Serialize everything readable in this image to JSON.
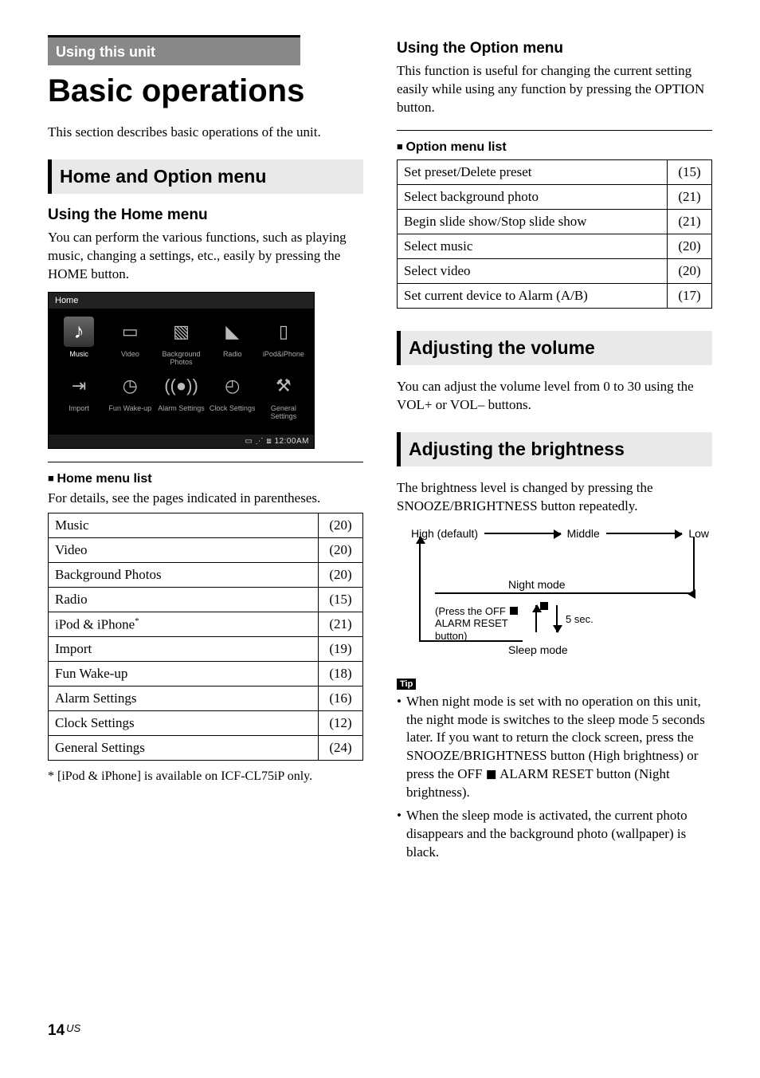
{
  "section_tag": "Using this unit",
  "page_title": "Basic operations",
  "intro": "This section describes basic operations of the unit.",
  "home_option_heading": "Home and Option menu",
  "using_home_heading": "Using the Home menu",
  "using_home_body": "You can perform the various functions, such as playing music, changing a settings, etc., easily by pressing the HOME button.",
  "screenshot": {
    "title": "Home",
    "items": [
      {
        "label": "Music",
        "glyph": "♪",
        "selected": true
      },
      {
        "label": "Video",
        "glyph": "▭",
        "selected": false
      },
      {
        "label": "Background Photos",
        "glyph": "▧",
        "selected": false
      },
      {
        "label": "Radio",
        "glyph": "◣",
        "selected": false
      },
      {
        "label": "iPod&iPhone",
        "glyph": "▯",
        "selected": false
      },
      {
        "label": "Import",
        "glyph": "⇥",
        "selected": false
      },
      {
        "label": "Fun Wake-up",
        "glyph": "◷",
        "selected": false
      },
      {
        "label": "Alarm Settings",
        "glyph": "((●))",
        "selected": false
      },
      {
        "label": "Clock Settings",
        "glyph": "◴",
        "selected": false
      },
      {
        "label": "General Settings",
        "glyph": "⚒",
        "selected": false
      }
    ],
    "status": "▭ ⋰ ⧈ 12:00AM"
  },
  "home_list_heading": "Home menu list",
  "home_list_caption": "For details, see the pages indicated in parentheses.",
  "home_list": [
    {
      "label": "Music",
      "page": "(20)"
    },
    {
      "label": "Video",
      "page": "(20)"
    },
    {
      "label": "Background Photos",
      "page": "(20)"
    },
    {
      "label": "Radio",
      "page": "(15)"
    },
    {
      "label": "iPod & iPhone",
      "sup": "*",
      "page": "(21)"
    },
    {
      "label": "Import",
      "page": "(19)"
    },
    {
      "label": "Fun Wake-up",
      "page": "(18)"
    },
    {
      "label": "Alarm Settings",
      "page": "(16)"
    },
    {
      "label": "Clock Settings",
      "page": "(12)"
    },
    {
      "label": "General Settings",
      "page": "(24)"
    }
  ],
  "footnote": "*  [iPod & iPhone] is available on ICF-CL75iP only.",
  "using_option_heading": "Using the Option menu",
  "using_option_body": "This function is useful for changing the current setting easily while using any function by pressing the OPTION button.",
  "option_list_heading": "Option menu list",
  "option_list": [
    {
      "label": "Set preset/Delete preset",
      "page": "(15)"
    },
    {
      "label": "Select background photo",
      "page": "(21)"
    },
    {
      "label": "Begin slide show/Stop slide show",
      "page": "(21)"
    },
    {
      "label": "Select music",
      "page": "(20)"
    },
    {
      "label": "Select video",
      "page": "(20)"
    },
    {
      "label": "Set current device to Alarm (A/B)",
      "page": "(17)"
    }
  ],
  "adj_volume_heading": "Adjusting the volume",
  "adj_volume_body": "You can adjust the volume level from 0 to 30 using the VOL+ or VOL– buttons.",
  "adj_bright_heading": "Adjusting the brightness",
  "adj_bright_body": "The brightness level is changed by pressing the SNOOZE/BRIGHTNESS button repeatedly.",
  "bright_diagram": {
    "high": "High (default)",
    "middle": "Middle",
    "low": "Low",
    "night_mode": "Night mode",
    "press_note_l1": "(Press the OFF",
    "press_note_l2": "ALARM RESET",
    "press_note_l3": "button)",
    "five_sec": "5 sec.",
    "sleep_mode": "Sleep mode"
  },
  "tip_tag": "Tip",
  "tips": [
    "When night mode is set with no operation on this unit, the night mode is switches to the sleep mode 5 seconds later. If you want to return the clock screen, press the SNOOZE/BRIGHTNESS button (High brightness) or press the OFF ◼ ALARM RESET button (Night brightness).",
    "When the sleep mode is activated, the current photo disappears and the background photo (wallpaper) is black."
  ],
  "page_number": "14",
  "page_region": "US"
}
